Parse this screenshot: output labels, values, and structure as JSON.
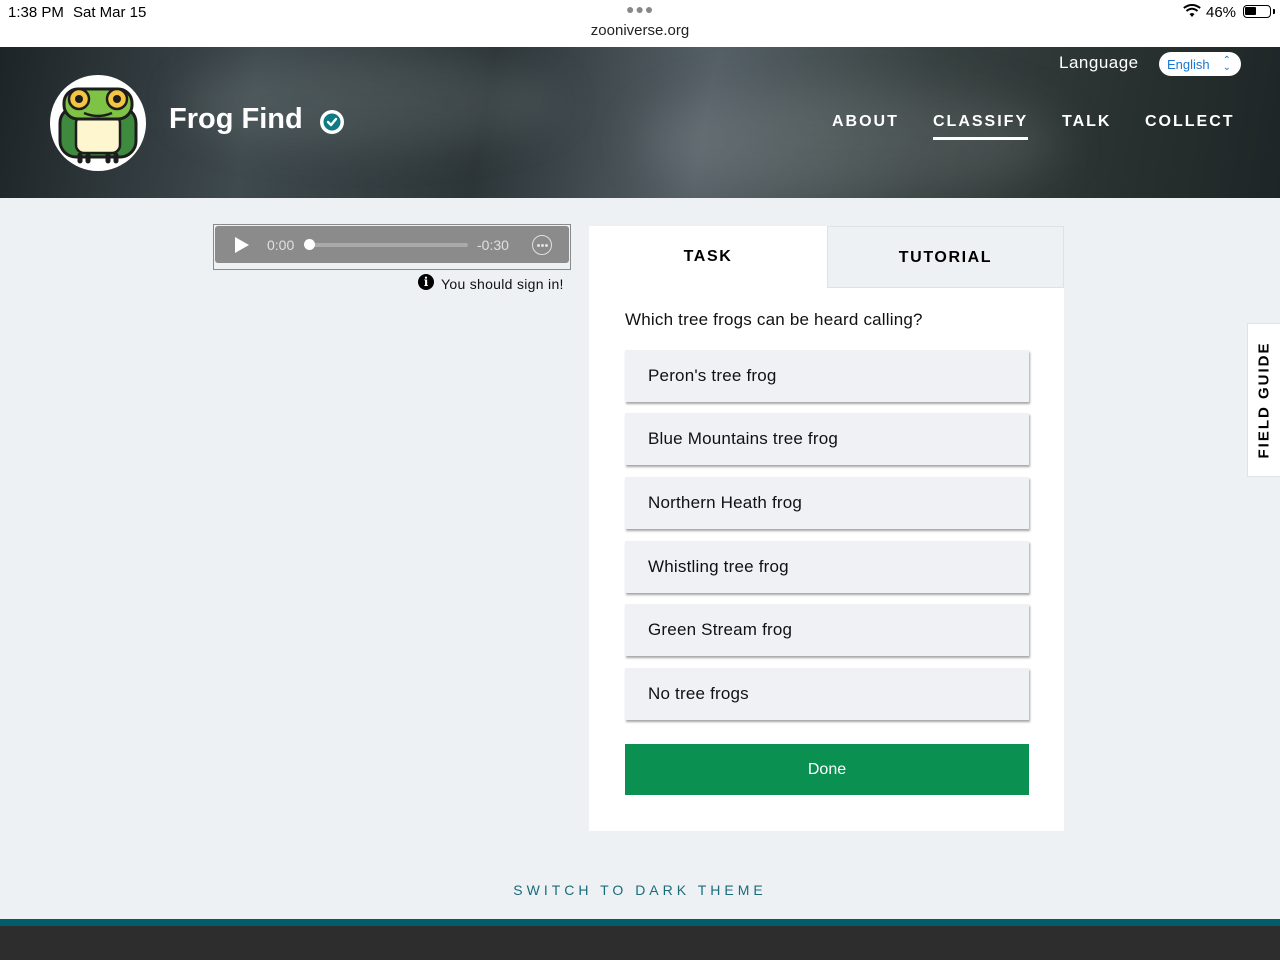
{
  "status_bar": {
    "time": "1:38 PM",
    "date": "Sat Mar 15",
    "url": "zooniverse.org",
    "battery": "46%",
    "battery_level": 0.46
  },
  "header": {
    "project_title": "Frog Find",
    "language_label": "Language",
    "language_value": "English",
    "nav": [
      "ABOUT",
      "CLASSIFY",
      "TALK",
      "COLLECT"
    ],
    "active_nav": "CLASSIFY"
  },
  "audio": {
    "current_time": "0:00",
    "remaining_time": "-0:30",
    "signin_notice": "You should sign in!"
  },
  "task_panel": {
    "tabs": [
      "TASK",
      "TUTORIAL"
    ],
    "active_tab": "TASK",
    "question": "Which tree frogs can be heard calling?",
    "answers": [
      "Peron's tree frog",
      "Blue Mountains tree frog",
      "Northern Heath frog",
      "Whistling tree frog",
      "Green Stream frog",
      "No tree frogs"
    ],
    "done_label": "Done"
  },
  "field_guide_label": "FIELD GUIDE",
  "dark_theme_label": "SWITCH TO DARK THEME",
  "colors": {
    "done_button": "#0a9152",
    "accent_teal": "#005d69",
    "language_text": "#1a76d2"
  }
}
